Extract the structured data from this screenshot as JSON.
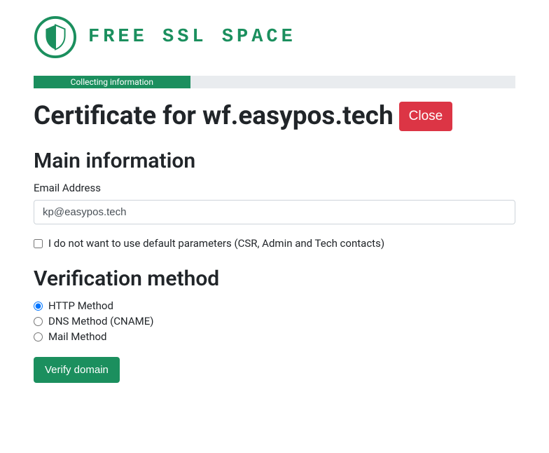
{
  "brand": {
    "name": "FREE SSL SPACE"
  },
  "progress": {
    "current_step_label": "Collecting information"
  },
  "title": {
    "prefix": "Certificate for ",
    "domain": "wf.easypos.tech"
  },
  "close_button": "Close",
  "sections": {
    "main_info": {
      "heading": "Main information",
      "email_label": "Email Address",
      "email_value": "kp@easypos.tech",
      "no_default_params_label": "I do not want to use default parameters (CSR, Admin and Tech contacts)",
      "no_default_params_checked": false
    },
    "verification": {
      "heading": "Verification method",
      "options": [
        {
          "label": "HTTP Method",
          "selected": true
        },
        {
          "label": "DNS Method (CNAME)",
          "selected": false
        },
        {
          "label": "Mail Method",
          "selected": false
        }
      ]
    }
  },
  "verify_button": "Verify domain",
  "colors": {
    "primary": "#1b8f5e",
    "danger": "#dc3545"
  }
}
